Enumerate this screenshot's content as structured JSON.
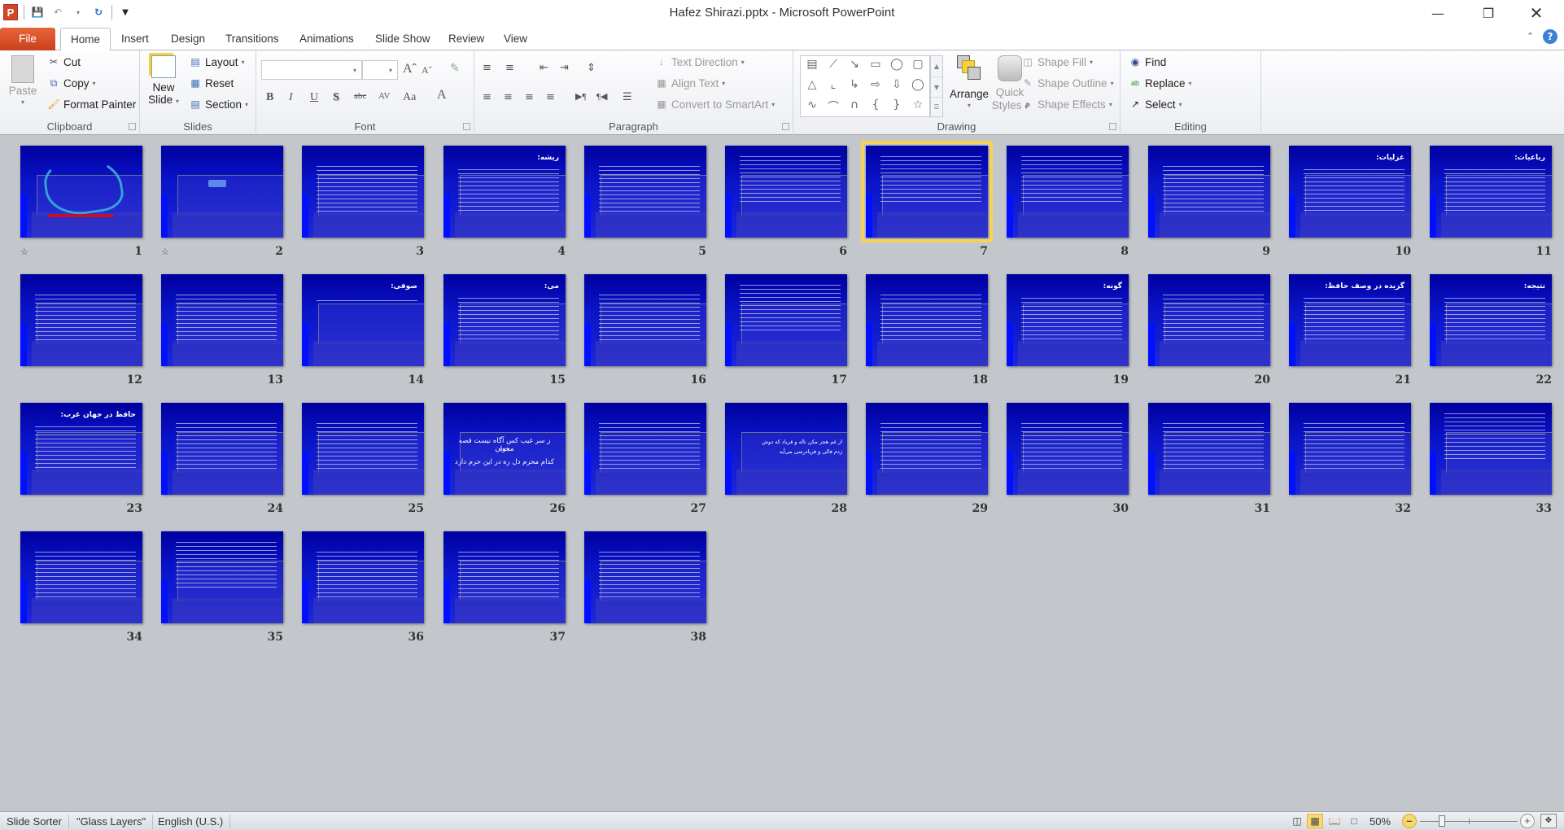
{
  "titlebar": {
    "title": "Hafez Shirazi.pptx  -  Microsoft PowerPoint",
    "app_icon": "P",
    "qat": [
      "save-icon",
      "undo-icon",
      "redo-icon",
      "customize-qat-icon"
    ]
  },
  "tabs": [
    {
      "label": "File"
    },
    {
      "label": "Home",
      "active": true
    },
    {
      "label": "Insert"
    },
    {
      "label": "Design"
    },
    {
      "label": "Transitions"
    },
    {
      "label": "Animations"
    },
    {
      "label": "Slide Show"
    },
    {
      "label": "Review"
    },
    {
      "label": "View"
    }
  ],
  "ribbon": {
    "clipboard": {
      "label": "Clipboard",
      "paste": "Paste",
      "cut": "Cut",
      "copy": "Copy",
      "format_painter": "Format Painter"
    },
    "slides": {
      "label": "Slides",
      "new_slide_1": "New",
      "new_slide_2": "Slide",
      "layout": "Layout",
      "reset": "Reset",
      "section": "Section"
    },
    "font": {
      "label": "Font",
      "font_name": "",
      "font_size": ""
    },
    "paragraph": {
      "label": "Paragraph",
      "text_direction": "Text Direction",
      "align_text": "Align Text",
      "convert_smartart": "Convert to SmartArt"
    },
    "drawing": {
      "label": "Drawing",
      "arrange": "Arrange",
      "quick_styles_1": "Quick",
      "quick_styles_2": "Styles",
      "shape_fill": "Shape Fill",
      "shape_outline": "Shape Outline",
      "shape_effects": "Shape Effects"
    },
    "editing": {
      "label": "Editing",
      "find": "Find",
      "replace": "Replace",
      "select": "Select"
    }
  },
  "slides": [
    {
      "n": "1",
      "kind": "calligraphy",
      "transition": true
    },
    {
      "n": "2",
      "kind": "logo",
      "transition": true
    },
    {
      "n": "3",
      "kind": "text"
    },
    {
      "n": "4",
      "kind": "text",
      "title": "ریشه:"
    },
    {
      "n": "5",
      "kind": "text"
    },
    {
      "n": "6",
      "kind": "dense"
    },
    {
      "n": "7",
      "kind": "dense",
      "selected": true
    },
    {
      "n": "8",
      "kind": "dense"
    },
    {
      "n": "9",
      "kind": "text"
    },
    {
      "n": "10",
      "kind": "text",
      "title": "غزلیات:"
    },
    {
      "n": "11",
      "kind": "text",
      "title": "رباعیات:"
    },
    {
      "n": "12",
      "kind": "text"
    },
    {
      "n": "13",
      "kind": "text"
    },
    {
      "n": "14",
      "kind": "sparse",
      "title": "صوفی:"
    },
    {
      "n": "15",
      "kind": "text",
      "title": "می:"
    },
    {
      "n": "16",
      "kind": "text"
    },
    {
      "n": "17",
      "kind": "dense"
    },
    {
      "n": "18",
      "kind": "text"
    },
    {
      "n": "19",
      "kind": "text",
      "title": "گونه:"
    },
    {
      "n": "20",
      "kind": "text"
    },
    {
      "n": "21",
      "kind": "text",
      "title": "گزیده در وصف حافظ:"
    },
    {
      "n": "22",
      "kind": "text",
      "title": "نتیجه:"
    },
    {
      "n": "23",
      "kind": "text",
      "title": "حافظ در جهان غرب:"
    },
    {
      "n": "24",
      "kind": "text"
    },
    {
      "n": "25",
      "kind": "text"
    },
    {
      "n": "26",
      "kind": "verse",
      "lines": [
        "ز سر غیب کس آگاه نیست قصه مخوان",
        "***",
        "کدام محرم دل ره در این حرم دارد"
      ]
    },
    {
      "n": "27",
      "kind": "text"
    },
    {
      "n": "28",
      "kind": "verse-small",
      "lines": [
        "از غم هجر مکن ناله و فریاد که دوش",
        "زدم فالی و فریادرسی می‌آید"
      ]
    },
    {
      "n": "29",
      "kind": "text"
    },
    {
      "n": "30",
      "kind": "text"
    },
    {
      "n": "31",
      "kind": "text"
    },
    {
      "n": "32",
      "kind": "text"
    },
    {
      "n": "33",
      "kind": "dense"
    },
    {
      "n": "34",
      "kind": "text"
    },
    {
      "n": "35",
      "kind": "dense"
    },
    {
      "n": "36",
      "kind": "text"
    },
    {
      "n": "37",
      "kind": "text"
    },
    {
      "n": "38",
      "kind": "text"
    }
  ],
  "statusbar": {
    "view": "Slide Sorter",
    "theme": "\"Glass Layers\"",
    "language": "English (U.S.)",
    "zoom": "50%",
    "zoom_level_percent": 50
  }
}
